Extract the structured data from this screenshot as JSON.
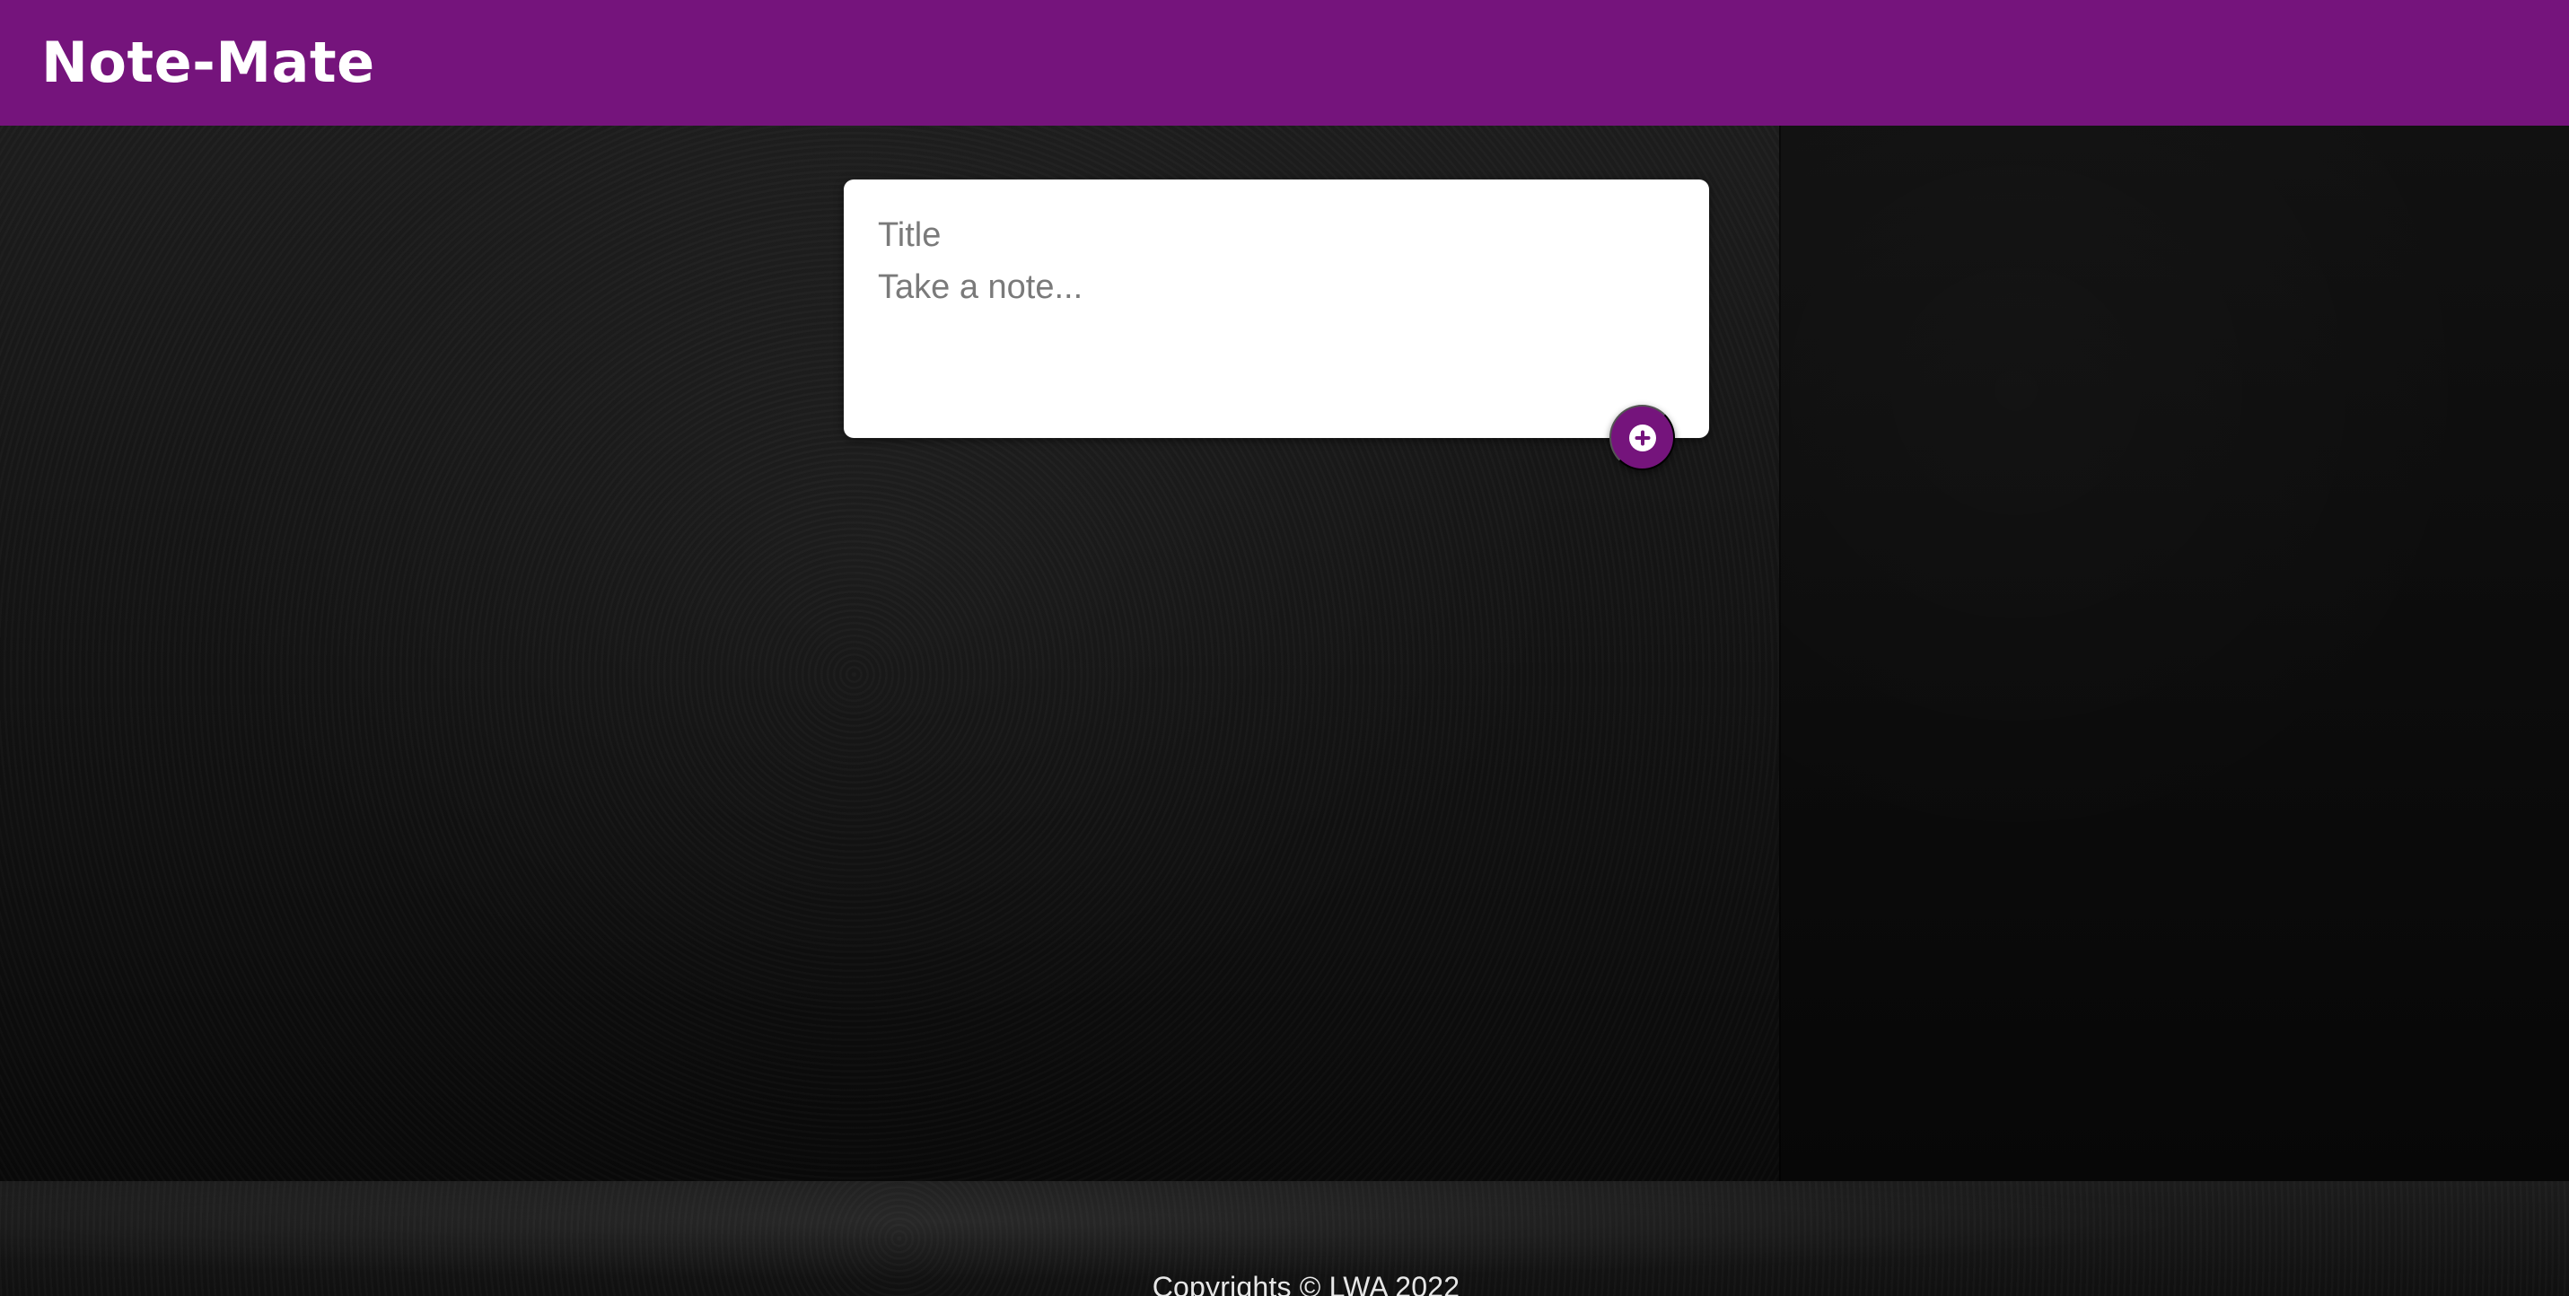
{
  "app": {
    "title": "Note-Mate"
  },
  "note_form": {
    "title_placeholder": "Title",
    "content_placeholder": "Take a note..."
  },
  "actions": {
    "add_icon": "plus-icon"
  },
  "footer": {
    "text": "Copyrights © LWA 2022"
  },
  "colors": {
    "brand": "#75147c",
    "card": "#ffffff",
    "background": "#121212",
    "footer_text": "#e7e7e7"
  }
}
